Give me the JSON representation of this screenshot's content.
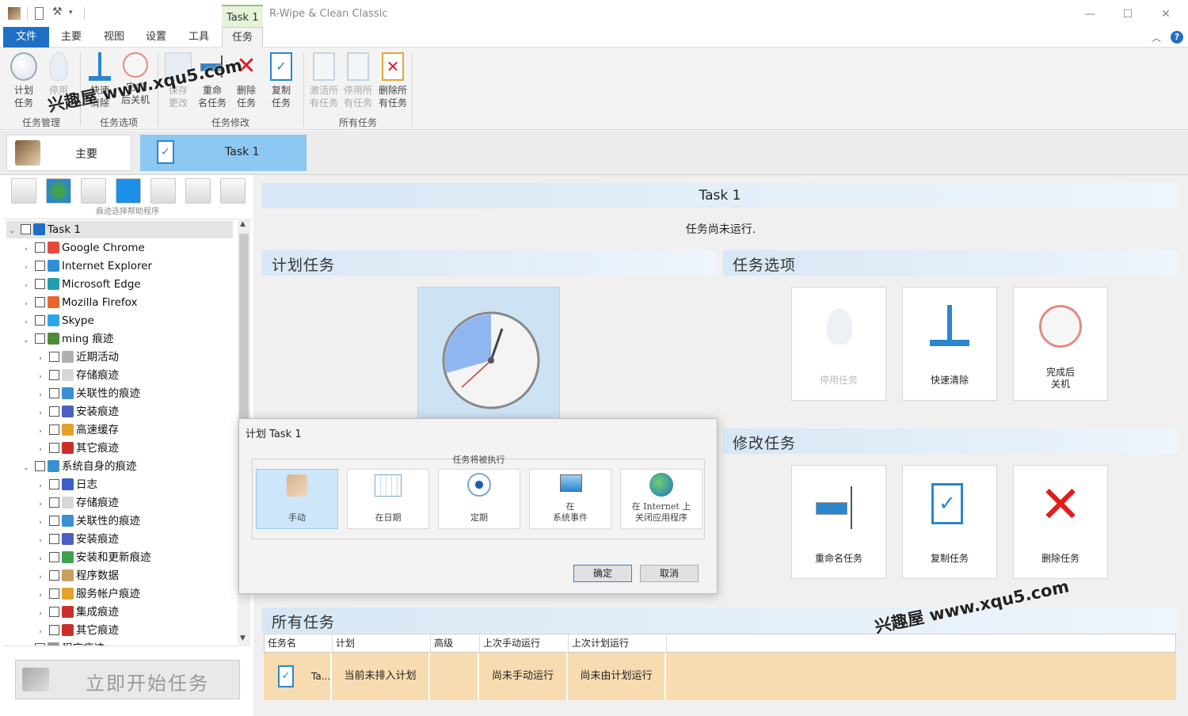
{
  "titlebar": {
    "context_tab": "Task 1",
    "app_title": "R-Wipe & Clean Classic",
    "min": "—",
    "max": "☐",
    "close": "✕",
    "help": "?",
    "collapse": "︿"
  },
  "ribbon_tabs": [
    "文件",
    "主要",
    "视图",
    "设置",
    "工具",
    "任务"
  ],
  "ribbon": {
    "groups": [
      {
        "label": "任务管理"
      },
      {
        "label": "任务选项"
      },
      {
        "label": "任务修改"
      },
      {
        "label": "所有任务"
      }
    ],
    "buttons": [
      {
        "l1": "计划",
        "l2": "任务",
        "icon": "clock-icon"
      },
      {
        "l1": "停用",
        "l2": "",
        "icon": "lightbulb-icon"
      },
      {
        "l1": "快速",
        "l2": "清除",
        "icon": "broom-icon"
      },
      {
        "l1": "完成",
        "l2": "后关机",
        "icon": "power-icon"
      },
      {
        "l1": "保存",
        "l2": "更改",
        "icon": "save-icon"
      },
      {
        "l1": "重命",
        "l2": "名任务",
        "icon": "rename-icon"
      },
      {
        "l1": "删除",
        "l2": "任务",
        "icon": "delete-icon"
      },
      {
        "l1": "复制",
        "l2": "任务",
        "icon": "copy-icon"
      },
      {
        "l1": "激活所",
        "l2": "有任务",
        "icon": "activate-all-icon"
      },
      {
        "l1": "停用所",
        "l2": "有任务",
        "icon": "disable-all-icon"
      },
      {
        "l1": "删除所",
        "l2": "有任务",
        "icon": "delete-all-icon"
      }
    ]
  },
  "doc_tabs": {
    "home": "主要",
    "task": "Task 1"
  },
  "left_panel": {
    "helper_label": "痕迹选择帮助程序",
    "tree": [
      {
        "label": "Task 1",
        "level": 0,
        "exp": "v",
        "color": "#1f6fc5"
      },
      {
        "label": "Google Chrome",
        "level": 1,
        "exp": ">",
        "color": "#e54b3c"
      },
      {
        "label": "Internet Explorer",
        "level": 1,
        "exp": ">",
        "color": "#2d8fd6"
      },
      {
        "label": "Microsoft Edge",
        "level": 1,
        "exp": ">",
        "color": "#1f9fb0"
      },
      {
        "label": "Mozilla Firefox",
        "level": 1,
        "exp": ">",
        "color": "#e8662b"
      },
      {
        "label": "Skype",
        "level": 1,
        "exp": ">",
        "color": "#2aa7e6"
      },
      {
        "label": "ming 痕迹",
        "level": 1,
        "exp": "v",
        "color": "#4c8a3c"
      },
      {
        "label": "近期活动",
        "level": 2,
        "exp": ">",
        "color": "#b0b0b0"
      },
      {
        "label": "存储痕迹",
        "level": 2,
        "exp": ">",
        "color": "#d8d8d8"
      },
      {
        "label": "关联性的痕迹",
        "level": 2,
        "exp": ">",
        "color": "#3a8fd1"
      },
      {
        "label": "安装痕迹",
        "level": 2,
        "exp": ">",
        "color": "#4d5fc2"
      },
      {
        "label": "高速缓存",
        "level": 2,
        "exp": ">",
        "color": "#e4a12b"
      },
      {
        "label": "其它痕迹",
        "level": 2,
        "exp": ">",
        "color": "#c9302c"
      },
      {
        "label": "系统自身的痕迹",
        "level": 1,
        "exp": "v",
        "color": "#3a8fd1"
      },
      {
        "label": "日志",
        "level": 2,
        "exp": ">",
        "color": "#3b5fc6"
      },
      {
        "label": "存储痕迹",
        "level": 2,
        "exp": ">",
        "color": "#d8d8d8"
      },
      {
        "label": "关联性的痕迹",
        "level": 2,
        "exp": ">",
        "color": "#3a8fd1"
      },
      {
        "label": "安装痕迹",
        "level": 2,
        "exp": ">",
        "color": "#4d5fc2"
      },
      {
        "label": "安装和更新痕迹",
        "level": 2,
        "exp": ">",
        "color": "#3fa34d"
      },
      {
        "label": "程序数据",
        "level": 2,
        "exp": ">",
        "color": "#c8a060"
      },
      {
        "label": "服务帐户痕迹",
        "level": 2,
        "exp": ">",
        "color": "#e4a12b"
      },
      {
        "label": "集成痕迹",
        "level": 2,
        "exp": ">",
        "color": "#c9302c"
      },
      {
        "label": "其它痕迹",
        "level": 2,
        "exp": ">",
        "color": "#c9302c"
      },
      {
        "label": "程序痕迹",
        "level": 1,
        "exp": ">",
        "color": "#999999"
      }
    ],
    "start_button": "立即开始任务"
  },
  "main": {
    "title": "Task 1",
    "status": "任务尚未运行.",
    "schedule_section": "计划任务",
    "options_section": "任务选项",
    "options_cards": [
      {
        "label": "停用任务",
        "icon": "lightbulb-icon"
      },
      {
        "label": "快速清除",
        "icon": "broom-icon"
      },
      {
        "label": "完成后\n关机",
        "icon": "power-icon"
      }
    ],
    "modify_section": "修改任务",
    "modify_cards": [
      {
        "label": "重命名任务",
        "icon": "rename-icon"
      },
      {
        "label": "复制任务",
        "icon": "copy-icon"
      },
      {
        "label": "删除任务",
        "icon": "delete-icon"
      }
    ],
    "all_tasks_section": "所有任务",
    "table": {
      "headers": [
        "任务名",
        "计划",
        "高级",
        "上次手动运行",
        "上次计划运行"
      ],
      "row": [
        "Ta...",
        "当前未排入计划",
        "",
        "尚未手动运行",
        "尚未由计划运行"
      ]
    }
  },
  "dialog": {
    "title": "计划 Task 1",
    "group_label": "任务将被执行",
    "options": [
      {
        "l1": "手动",
        "l2": "",
        "icon": "hand-icon"
      },
      {
        "l1": "在日期",
        "l2": "",
        "icon": "calendar-icon"
      },
      {
        "l1": "定期",
        "l2": "",
        "icon": "periodic-icon"
      },
      {
        "l1": "在",
        "l2": "系统事件",
        "icon": "computer-icon"
      },
      {
        "l1": "在 Internet 上",
        "l2": "关闭应用程序",
        "icon": "globe-icon"
      }
    ],
    "ok": "确定",
    "cancel": "取消"
  },
  "watermark": "兴趣屋 www.xqu5.com",
  "colors": {
    "accent": "#1f6fc5",
    "selected_tab": "#8dc8f2",
    "row_highlight": "#f8dcb1",
    "delete": "#e01e1e"
  }
}
